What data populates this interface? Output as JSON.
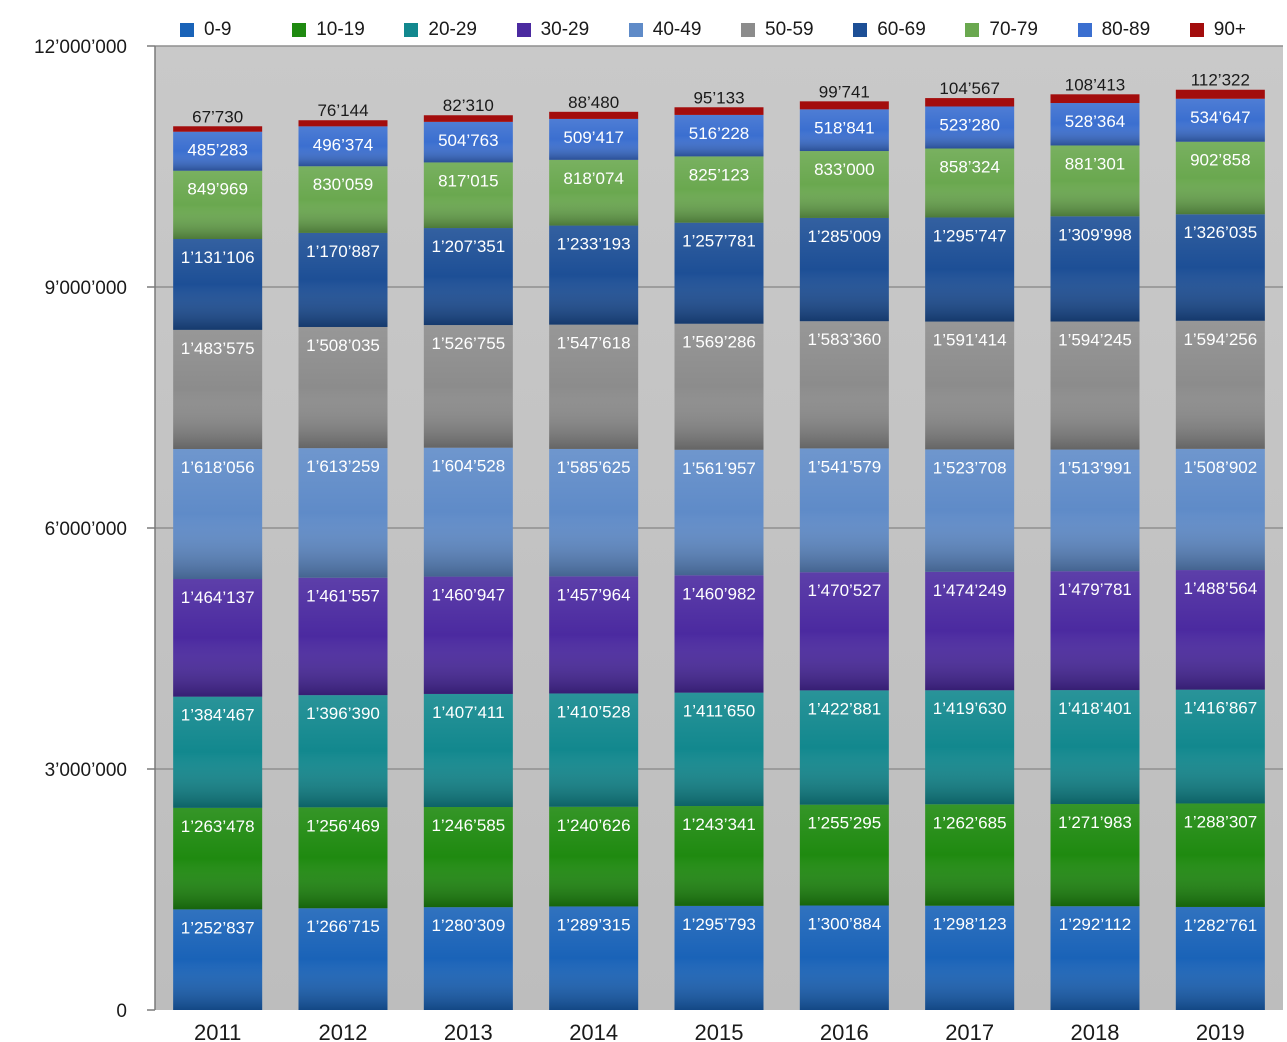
{
  "chart_data": {
    "type": "bar",
    "stacked": true,
    "title": "",
    "xlabel": "",
    "ylabel": "",
    "ylim": [
      0,
      12000000
    ],
    "yticks": [
      0,
      3000000,
      6000000,
      9000000,
      12000000
    ],
    "ytick_labels": [
      "0",
      "3’000’000",
      "6’000’000",
      "9’000’000",
      "12’000’000"
    ],
    "grid": true,
    "legend_position": "top",
    "categories": [
      "2011",
      "2012",
      "2013",
      "2014",
      "2015",
      "2016",
      "2017",
      "2018",
      "2019"
    ],
    "series": [
      {
        "name": "0-9",
        "color": "#1a63b8",
        "label_color": "#ffffff",
        "values": [
          1252837,
          1266715,
          1280309,
          1289315,
          1295793,
          1300884,
          1298123,
          1292112,
          1282761
        ],
        "labels": [
          "1’252’837",
          "1’266’715",
          "1’280’309",
          "1’289’315",
          "1’295’793",
          "1’300’884",
          "1’298’123",
          "1’292’112",
          "1’282’761"
        ]
      },
      {
        "name": "10-19",
        "color": "#1f8a10",
        "label_color": "#ffffff",
        "values": [
          1263478,
          1256469,
          1246585,
          1240626,
          1243341,
          1255295,
          1262685,
          1271983,
          1288307
        ],
        "labels": [
          "1’263’478",
          "1’256’469",
          "1’246’585",
          "1’240’626",
          "1’243’341",
          "1’255’295",
          "1’262’685",
          "1’271’983",
          "1’288’307"
        ]
      },
      {
        "name": "20-29",
        "color": "#12888e",
        "label_color": "#ffffff",
        "values": [
          1384467,
          1396390,
          1407411,
          1410528,
          1411650,
          1422881,
          1419630,
          1418401,
          1416867
        ],
        "labels": [
          "1’384’467",
          "1’396’390",
          "1’407’411",
          "1’410’528",
          "1’411’650",
          "1’422’881",
          "1’419’630",
          "1’418’401",
          "1’416’867"
        ]
      },
      {
        "name": "30-29",
        "color": "#4b2aa0",
        "label_color": "#ffffff",
        "values": [
          1464137,
          1461557,
          1460947,
          1457964,
          1460982,
          1470527,
          1474249,
          1479781,
          1488564
        ],
        "labels": [
          "1’464’137",
          "1’461’557",
          "1’460’947",
          "1’457’964",
          "1’460’982",
          "1’470’527",
          "1’474’249",
          "1’479’781",
          "1’488’564"
        ]
      },
      {
        "name": "40-49",
        "color": "#5f8bc8",
        "label_color": "#ffffff",
        "values": [
          1618056,
          1613259,
          1604528,
          1585625,
          1561957,
          1541579,
          1523708,
          1513991,
          1508902
        ],
        "labels": [
          "1’618’056",
          "1’613’259",
          "1’604’528",
          "1’585’625",
          "1’561’957",
          "1’541’579",
          "1’523’708",
          "1’513’991",
          "1’508’902"
        ]
      },
      {
        "name": "50-59",
        "color": "#8c8c8c",
        "label_color": "#ffffff",
        "values": [
          1483575,
          1508035,
          1526755,
          1547618,
          1569286,
          1583360,
          1591414,
          1594245,
          1594256
        ],
        "labels": [
          "1’483’575",
          "1’508’035",
          "1’526’755",
          "1’547’618",
          "1’569’286",
          "1’583’360",
          "1’591’414",
          "1’594’245",
          "1’594’256"
        ]
      },
      {
        "name": "60-69",
        "color": "#1d4f96",
        "label_color": "#ffffff",
        "values": [
          1131106,
          1170887,
          1207351,
          1233193,
          1257781,
          1285009,
          1295747,
          1309998,
          1326035
        ],
        "labels": [
          "1’131’106",
          "1’170’887",
          "1’207’351",
          "1’233’193",
          "1’257’781",
          "1’285’009",
          "1’295’747",
          "1’309’998",
          "1’326’035"
        ]
      },
      {
        "name": "70-79",
        "color": "#6aa84f",
        "label_color": "#ffffff",
        "values": [
          849969,
          830059,
          817015,
          818074,
          825123,
          833000,
          858324,
          881301,
          902858
        ],
        "labels": [
          "849’969",
          "830’059",
          "817’015",
          "818’074",
          "825’123",
          "833’000",
          "858’324",
          "881’301",
          "902’858"
        ]
      },
      {
        "name": "80-89",
        "color": "#3b6fd0",
        "label_color": "#ffffff",
        "values": [
          485283,
          496374,
          504763,
          509417,
          516228,
          518841,
          523280,
          528364,
          534647
        ],
        "labels": [
          "485’283",
          "496’374",
          "504’763",
          "509’417",
          "516’228",
          "518’841",
          "523’280",
          "528’364",
          "534’647"
        ]
      },
      {
        "name": "90+",
        "color": "#a30d0d",
        "label_color": "#1a1a1a",
        "values": [
          67730,
          76144,
          82310,
          88480,
          95133,
          99741,
          104567,
          108413,
          112322
        ],
        "labels": [
          "67’730",
          "76’144",
          "82’310",
          "88’480",
          "95’133",
          "99’741",
          "104’567",
          "108’413",
          "112’322"
        ]
      }
    ]
  }
}
